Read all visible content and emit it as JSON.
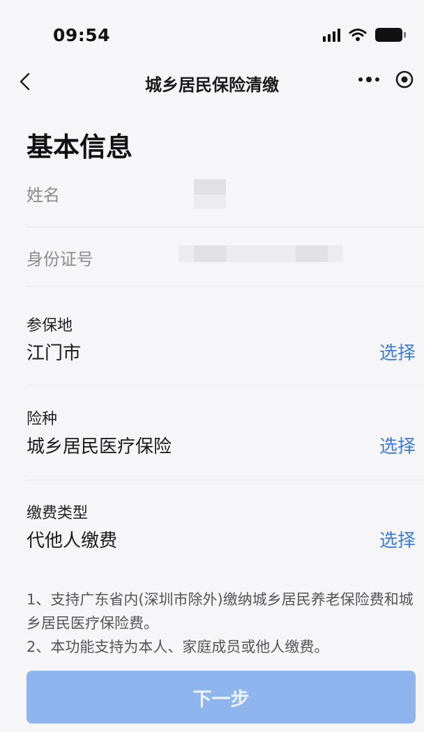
{
  "status_bar": {
    "time": "09:54"
  },
  "nav": {
    "title": "城乡居民保险清缴"
  },
  "form": {
    "section_title": "基本信息",
    "name_label": "姓名",
    "id_label": "身份证号",
    "fields": [
      {
        "label": "参保地",
        "value": "江门市",
        "action": "选择"
      },
      {
        "label": "险种",
        "value": "城乡居民医疗保险",
        "action": "选择"
      },
      {
        "label": "缴费类型",
        "value": "代他人缴费",
        "action": "选择"
      }
    ]
  },
  "notes": [
    "1、支持广东省内(深圳市除外)缴纳城乡居民养老保险费和城乡居民医疗保险费。",
    "2、本功能支持为本人、家庭成员或他人缴费。"
  ],
  "footer": {
    "next_label": "下一步"
  },
  "colors": {
    "link": "#3d7bd9",
    "button": "#8fb5ef",
    "background": "#f6f6f8"
  }
}
